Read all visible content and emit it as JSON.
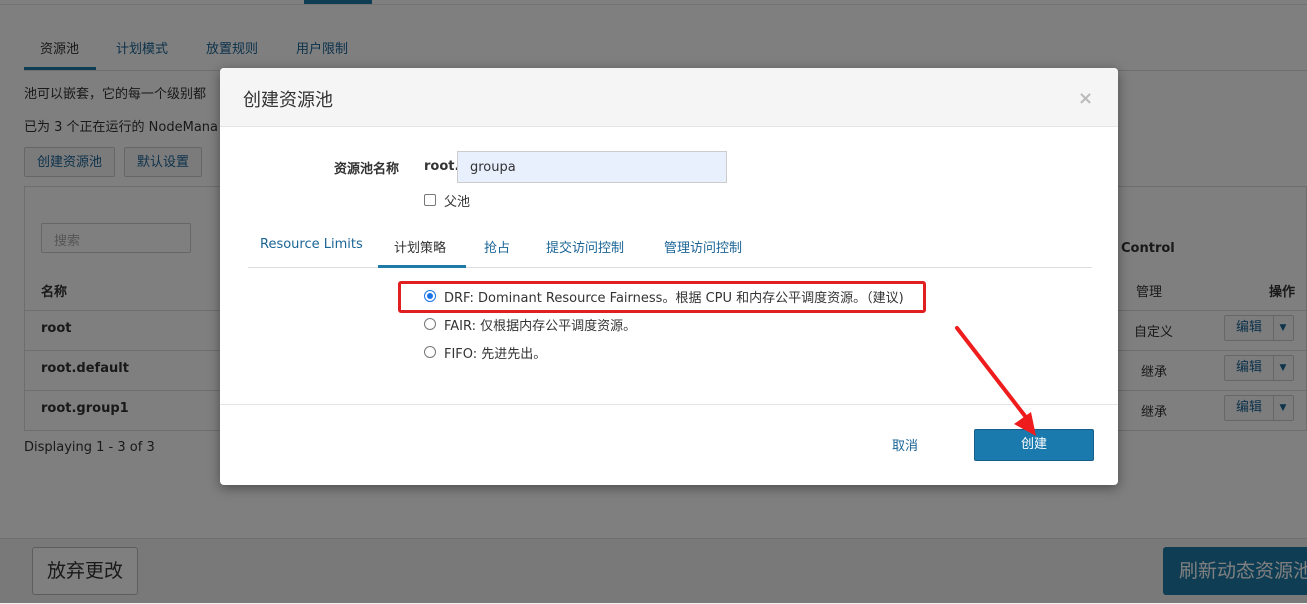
{
  "page": {
    "tabs": [
      {
        "label": "资源池",
        "active": true
      },
      {
        "label": "计划模式",
        "active": false
      },
      {
        "label": "放置规则",
        "active": false
      },
      {
        "label": "用户限制",
        "active": false
      }
    ],
    "description_1": "池可以嵌套，它的每一个级别都",
    "description_2": "已为 3 个正在运行的 NodeMana",
    "create_pool_button": "创建资源池",
    "default_settings_button": "默认设置",
    "search_placeholder": "搜索",
    "table": {
      "name_header": "名称",
      "control_header": "Control",
      "manage_header": "管理",
      "actions_header": "操作",
      "rows": [
        {
          "name": "root",
          "manage": "自定义",
          "action": "编辑"
        },
        {
          "name": "root.default",
          "manage": "继承",
          "action": "编辑"
        },
        {
          "name": "root.group1",
          "manage": "继承",
          "action": "编辑"
        }
      ]
    },
    "displaying": "Displaying 1 - 3 of 3",
    "discard_button": "放弃更改",
    "refresh_button": "刷新动态资源池"
  },
  "modal": {
    "title": "创建资源池",
    "close": "×",
    "name_label": "资源池名称",
    "name_prefix": "root.",
    "name_value": "groupa",
    "parent_checkbox_label": "父池",
    "parent_checked": false,
    "tabs": [
      {
        "label": "Resource Limits",
        "active": false
      },
      {
        "label": "计划策略",
        "active": true
      },
      {
        "label": "抢占",
        "active": false
      },
      {
        "label": "提交访问控制",
        "active": false
      },
      {
        "label": "管理访问控制",
        "active": false
      }
    ],
    "policies": [
      {
        "label": "DRF: Dominant Resource Fairness。根据 CPU 和内存公平调度资源。（建议)",
        "checked": true
      },
      {
        "label": "FAIR: 仅根据内存公平调度资源。",
        "checked": false
      },
      {
        "label": "FIFO: 先进先出。",
        "checked": false
      }
    ],
    "cancel_button": "取消",
    "create_button": "创建"
  },
  "colors": {
    "accent": "#1f7aa8",
    "highlight": "#e02020",
    "link": "#1a6496"
  }
}
